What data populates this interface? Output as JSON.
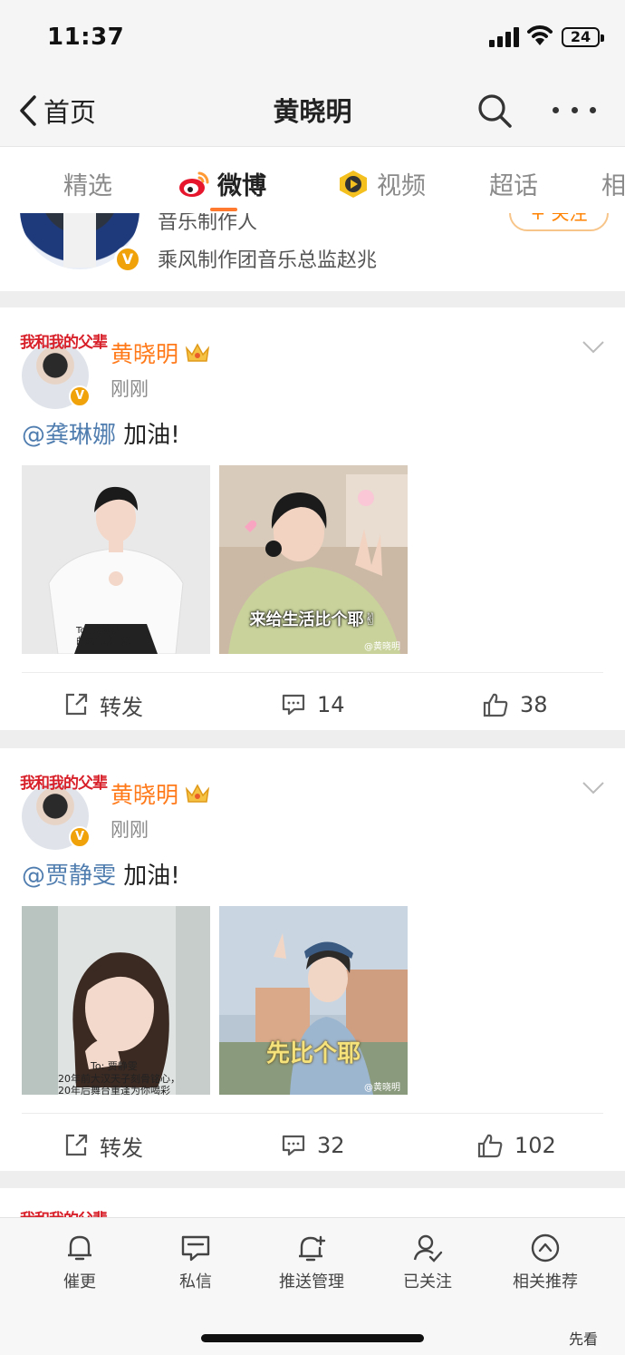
{
  "status_bar": {
    "time": "11:37",
    "battery": "24"
  },
  "nav": {
    "back_label": "首页",
    "title": "黄晓明"
  },
  "tabs": [
    {
      "label": "精选"
    },
    {
      "label": "微博"
    },
    {
      "label": "视频"
    },
    {
      "label": "超话"
    },
    {
      "label": "相"
    }
  ],
  "profile_card": {
    "line1": "音乐制作人",
    "line2": "乘风制作团音乐总监赵兆",
    "follow_label": "+ 关注"
  },
  "posts": [
    {
      "author": "黄晓明",
      "avatar_text": "我和我的父辈",
      "time": "刚刚",
      "mention": "@龚琳娜",
      "text": " 加油!",
      "image1_note1": "To: 龚琳娜",
      "image1_note2": "曲风自成一派",
      "image2_caption": "来给生活比个耶✌",
      "image2_wm": "@黄晓明",
      "repost_label": "转发",
      "comments": "14",
      "likes": "38"
    },
    {
      "author": "黄晓明",
      "avatar_text": "我和我的父辈",
      "time": "刚刚",
      "mention": "@贾静雯",
      "text": " 加油!",
      "image1_note1": "To: 贾静雯",
      "image1_note2": "20年前大汉天子刻骨铭心，",
      "image1_note3": "20年后舞台重逢为你喝彩",
      "image2_caption": "先比个耶",
      "image2_wm": "@黄晓明",
      "repost_label": "转发",
      "comments": "32",
      "likes": "102"
    }
  ],
  "post3": {
    "avatar_text": "我和我的父辈"
  },
  "bottom_nav": [
    {
      "label": "催更"
    },
    {
      "label": "私信"
    },
    {
      "label": "推送管理"
    },
    {
      "label": "已关注"
    },
    {
      "label": "相关推荐"
    }
  ],
  "watermark": "先看",
  "colors": {
    "accent": "#ff7a2e",
    "username": "#ff7a1a",
    "mention": "#507daf",
    "verified": "#f0a20a"
  }
}
